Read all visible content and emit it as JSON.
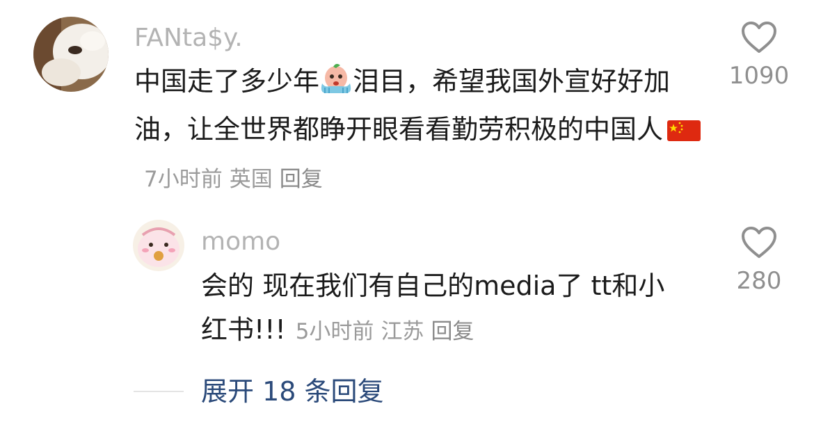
{
  "comment": {
    "username": "FANta$y.",
    "text_before_emoji": "中国走了多少年",
    "emoji_name": "crying-face-sticker",
    "text_after_emoji": "泪目，希望我国外宣好好加油，让全世界都睁开眼看看勤劳积极的中国人",
    "flag_emoji": "china-flag",
    "time": "7小时前",
    "location": "英国",
    "reply_label": "回复",
    "likes": "1090"
  },
  "reply": {
    "username": "momo",
    "text": "会的 现在我们有自己的media了 tt和小红书!!!",
    "time": "5小时前",
    "location": "江苏",
    "reply_label": "回复",
    "likes": "280"
  },
  "expand_label": "展开 18 条回复",
  "colors": {
    "username": "#b3b3b3",
    "meta": "#9a9a9a",
    "expand_link": "#2b4a7a",
    "heart_outline": "#8f8f8f"
  }
}
